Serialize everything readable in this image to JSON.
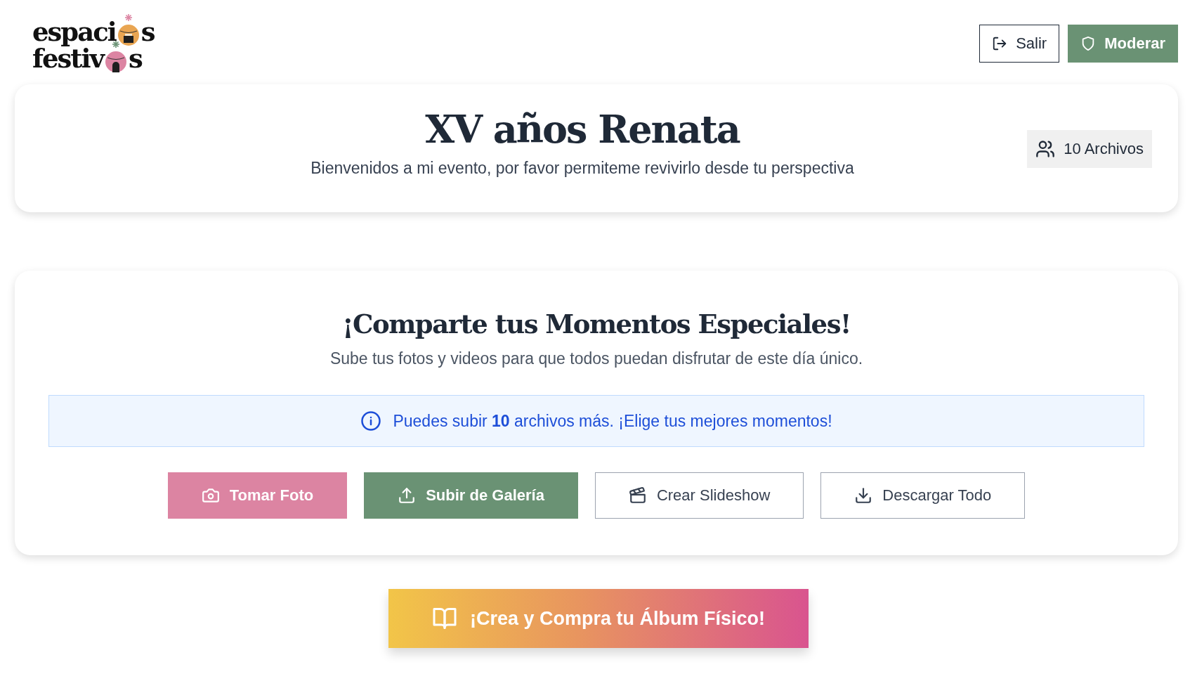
{
  "logo": {
    "line_1": "espaci",
    "line_1_end": "s",
    "line_2": "festiv",
    "line_2_end": "s"
  },
  "header_buttons": [
    {
      "kind": "outline",
      "label": "Salir"
    },
    {
      "kind": "green",
      "label": "Moderar"
    }
  ],
  "event": {
    "title": "XV años Renata",
    "subtitle": "Bienvenidos a mi evento, por favor permiteme revivirlo desde tu perspectiva",
    "file_count": "10 Archivos"
  },
  "share": {
    "heading": "¡Comparte tus Momentos Especiales!",
    "text": "Sube tus fotos y videos para que todos puedan disfrutar de este día único.",
    "notice": "Puedes subir **10** archivos más. ¡Elige tus mejores momentos!",
    "actions": [
      {
        "kind": "pink",
        "label": "Tomar Foto"
      },
      {
        "kind": "green",
        "label": "Subir de Galería"
      },
      {
        "kind": "outline",
        "label": "Crear Slideshow"
      },
      {
        "kind": "outline",
        "label": "Descargar Todo"
      }
    ]
  },
  "album_button": {
    "label": "¡Crea y Compra tu Álbum Físico!"
  }
}
